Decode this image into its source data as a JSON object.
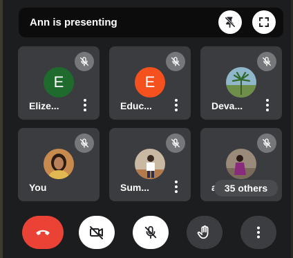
{
  "presenting": {
    "text": "Ann is presenting"
  },
  "tiles": [
    {
      "name": "Elize...",
      "avatar_letter": "E",
      "avatar_color": "#1e6b2d"
    },
    {
      "name": "Educ...",
      "avatar_letter": "E",
      "avatar_color": "#f4511e"
    },
    {
      "name": "Deva..."
    },
    {
      "name": "You"
    },
    {
      "name": "Sum..."
    },
    {
      "name": "ar..."
    }
  ],
  "others": {
    "label": "35 others"
  },
  "colors": {
    "end_call": "#ea4335",
    "tile_bg": "#3b3c3f",
    "control_dark": "#3c3d40",
    "control_light": "#ffffff"
  },
  "icons": {
    "unpin": "pin-off-icon",
    "fullscreen": "fullscreen-icon",
    "mic_off": "mic-off-icon",
    "end_call": "phone-hangup-icon",
    "camera_off": "camera-off-icon",
    "raise_hand": "hand-icon",
    "more": "more-vert-icon"
  }
}
